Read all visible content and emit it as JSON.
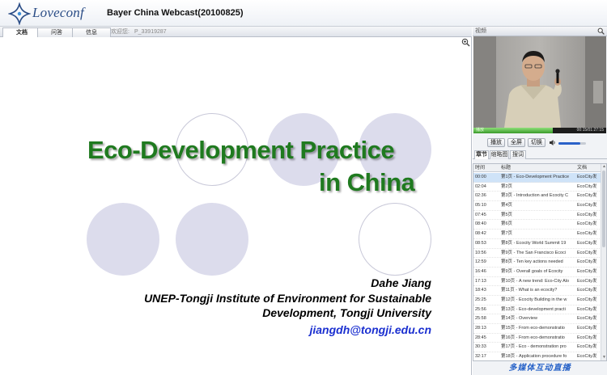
{
  "header": {
    "logo_text": "Loveconf",
    "title": "Bayer China Webcast(20100825)"
  },
  "tabs": [
    {
      "label": "文档",
      "active": true
    },
    {
      "label": "问答",
      "active": false
    },
    {
      "label": "信息",
      "active": false
    }
  ],
  "welcome": {
    "prefix": "欢迎您:",
    "user": "P_33919287"
  },
  "slide": {
    "title_line1": "Eco-Development Practice",
    "title_line2": "in China",
    "author": "Dahe Jiang",
    "affiliation_line1": "UNEP-Tongji Institute of Environment for Sustainable",
    "affiliation_line2": "Development, Tongji University",
    "email": "jiangdh@tongji.edu.cn",
    "title_color": "#1f7a1f",
    "email_color": "#1a2fd0"
  },
  "video": {
    "header_label": "视频",
    "status_label": "播放",
    "time": "00:15/01:27:15",
    "progress": 0.6,
    "volume": 0.8,
    "controls": {
      "play": "播放",
      "fullscreen": "全屏",
      "switch": "切换"
    }
  },
  "subtabs": [
    {
      "label": "章节",
      "active": true
    },
    {
      "label": "缩略图",
      "active": false
    },
    {
      "label": "搜词",
      "active": false
    }
  ],
  "list": {
    "headers": {
      "time": "时间",
      "title": "标题",
      "doc": "文档"
    },
    "rows": [
      {
        "time": "00:00",
        "title": "第1页 - Eco-Development Practice",
        "doc": "EcoCity发",
        "selected": true
      },
      {
        "time": "02:04",
        "title": "第2页",
        "doc": "EcoCity发"
      },
      {
        "time": "02:36",
        "title": "第3页 - Introduction and Ecocity C",
        "doc": "EcoCity发"
      },
      {
        "time": "05:10",
        "title": "第4页",
        "doc": "EcoCity发"
      },
      {
        "time": "07:45",
        "title": "第5页",
        "doc": "EcoCity发"
      },
      {
        "time": "08:40",
        "title": "第6页",
        "doc": "EcoCity发"
      },
      {
        "time": "08:42",
        "title": "第7页",
        "doc": "EcoCity发"
      },
      {
        "time": "08:53",
        "title": "第8页 - Ecocity World Summit 19",
        "doc": "EcoCity发"
      },
      {
        "time": "10:56",
        "title": "第9页 - The San Francisco Ecoci",
        "doc": "EcoCity发"
      },
      {
        "time": "12:59",
        "title": "第8页 - Ten key actions needed",
        "doc": "EcoCity发"
      },
      {
        "time": "16:46",
        "title": "第9页 - Overall goals of Ecocity",
        "doc": "EcoCity发"
      },
      {
        "time": "17:13",
        "title": "第10页 - A new trend: Eco-City Alo",
        "doc": "EcoCity发"
      },
      {
        "time": "18:43",
        "title": "第11页 - What is an ecocity?",
        "doc": "EcoCity发"
      },
      {
        "time": "25:25",
        "title": "第12页 - Ecocity Building in the w",
        "doc": "EcoCity发"
      },
      {
        "time": "25:56",
        "title": "第13页 - Eco-development practi",
        "doc": "EcoCity发"
      },
      {
        "time": "25:58",
        "title": "第14页 - Overview",
        "doc": "EcoCity发"
      },
      {
        "time": "28:13",
        "title": "第15页 - From eco-demonstratio",
        "doc": "EcoCity发"
      },
      {
        "time": "28:45",
        "title": "第16页 - From eco-demonstratio",
        "doc": "EcoCity发"
      },
      {
        "time": "30:33",
        "title": "第17页 - Eco - demonstration pro",
        "doc": "EcoCity发"
      },
      {
        "time": "32:17",
        "title": "第18页 - Application procedure fo",
        "doc": "EcoCity发"
      }
    ]
  },
  "footer": {
    "brand": "多媒体互动直播"
  }
}
